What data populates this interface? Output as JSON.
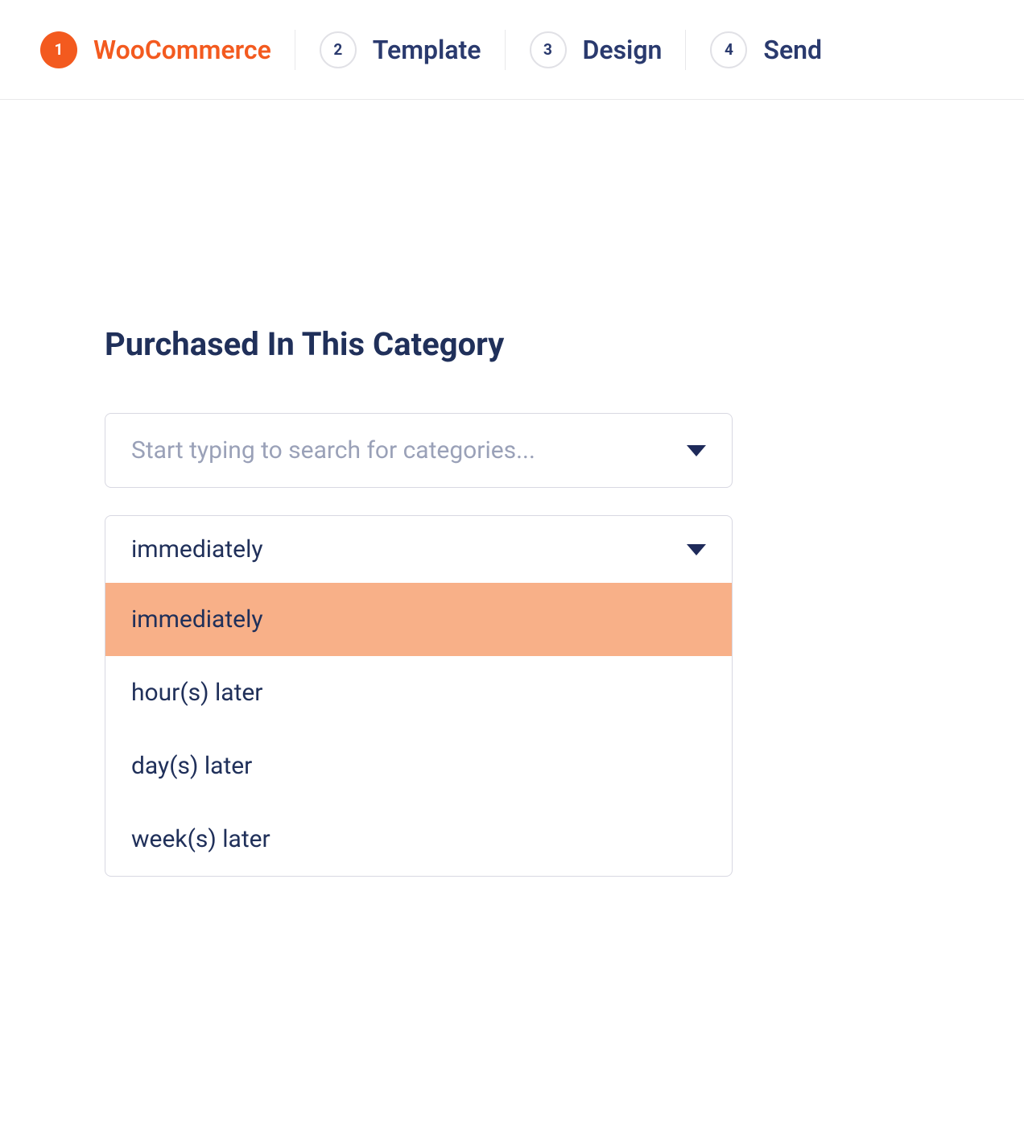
{
  "stepper": {
    "steps": [
      {
        "number": "1",
        "label": "WooCommerce",
        "active": true
      },
      {
        "number": "2",
        "label": "Template",
        "active": false
      },
      {
        "number": "3",
        "label": "Design",
        "active": false
      },
      {
        "number": "4",
        "label": "Send",
        "active": false
      }
    ]
  },
  "section": {
    "title": "Purchased In This Category"
  },
  "category_search": {
    "placeholder": "Start typing to search for categories..."
  },
  "timing_dropdown": {
    "selected": "immediately",
    "options": [
      {
        "label": "immediately",
        "highlighted": true
      },
      {
        "label": "hour(s) later",
        "highlighted": false
      },
      {
        "label": "day(s) later",
        "highlighted": false
      },
      {
        "label": "week(s) later",
        "highlighted": false
      }
    ]
  }
}
